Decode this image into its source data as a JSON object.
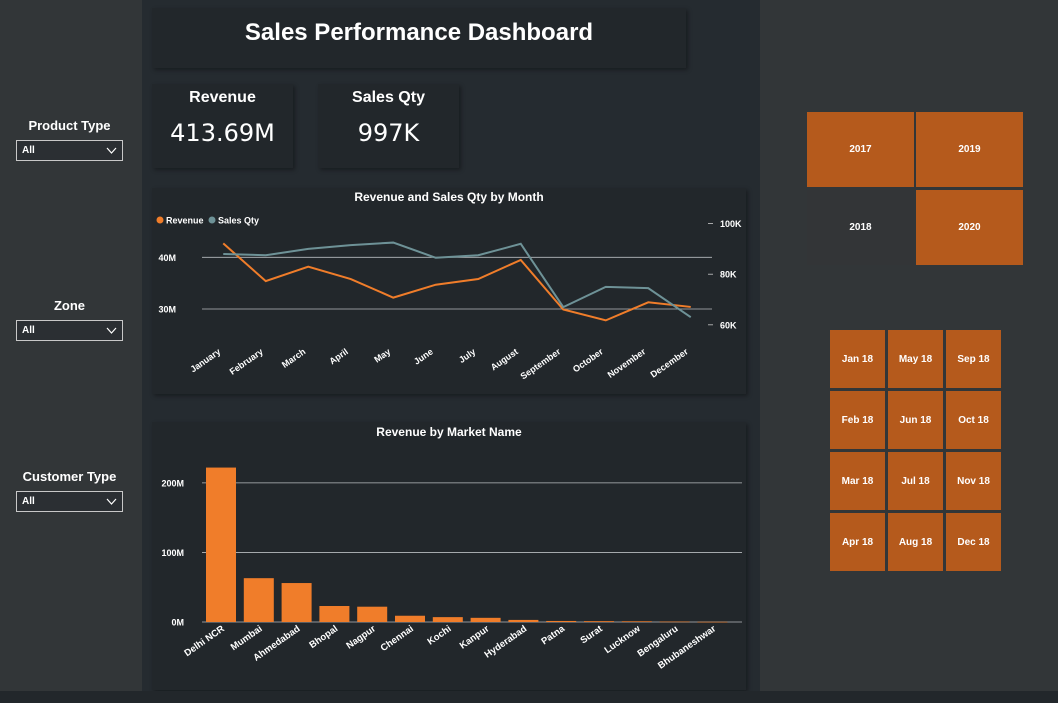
{
  "title": "Sales Performance Dashboard",
  "filters": [
    {
      "label": "Product Type",
      "value": "All"
    },
    {
      "label": "Zone",
      "value": "All"
    },
    {
      "label": "Customer Type",
      "value": "All"
    }
  ],
  "kpis": [
    {
      "label": "Revenue",
      "value": "413.69M"
    },
    {
      "label": "Sales Qty",
      "value": "997K"
    }
  ],
  "colors": {
    "accent": "#f07d2a",
    "secondary": "#6e9297",
    "tile_active": "#b55a1c",
    "tile_inactive": "#333537",
    "background": "#252b30",
    "panel": "#323638",
    "card": "#22272b"
  },
  "year_slicer": [
    {
      "label": "2017",
      "selected": true
    },
    {
      "label": "2019",
      "selected": true
    },
    {
      "label": "2018",
      "selected": false
    },
    {
      "label": "2020",
      "selected": true
    }
  ],
  "month_slicer": [
    "Jan 18",
    "May 18",
    "Sep 18",
    "Feb 18",
    "Jun 18",
    "Oct 18",
    "Mar 18",
    "Jul 18",
    "Nov 18",
    "Apr 18",
    "Aug 18",
    "Dec 18"
  ],
  "chart_data": [
    {
      "type": "line",
      "title": "Revenue and Sales Qty by Month",
      "legend_position": "top-left",
      "categories": [
        "January",
        "February",
        "March",
        "April",
        "May",
        "June",
        "July",
        "August",
        "September",
        "October",
        "November",
        "December"
      ],
      "series": [
        {
          "name": "Revenue",
          "axis": "left",
          "values": [
            42.7,
            35.4,
            38.2,
            35.8,
            32.2,
            34.7,
            35.8,
            39.5,
            29.9,
            27.8,
            31.3,
            30.4
          ]
        },
        {
          "name": "Sales Qty",
          "axis": "right",
          "values": [
            88,
            87.5,
            90,
            91.5,
            92.5,
            86.5,
            87.5,
            92,
            67,
            75,
            74.5,
            63
          ]
        }
      ],
      "y_left": {
        "ticks": [
          30,
          40
        ],
        "tick_labels": [
          "30M",
          "40M"
        ],
        "range": [
          24,
          48
        ]
      },
      "y_right": {
        "ticks": [
          60,
          80,
          100
        ],
        "tick_labels": [
          "60K",
          "80K",
          "100K"
        ],
        "range": [
          54,
          103
        ]
      },
      "grid": true
    },
    {
      "type": "bar",
      "title": "Revenue by Market Name",
      "categories": [
        "Delhi NCR",
        "Mumbai",
        "Ahmedabad",
        "Bhopal",
        "Nagpur",
        "Chennai",
        "Kochi",
        "Kanpur",
        "Hyderabad",
        "Patna",
        "Surat",
        "Lucknow",
        "Bengaluru",
        "Bhubaneshwar"
      ],
      "values": [
        222,
        63,
        56,
        23,
        22,
        9,
        7,
        6,
        3,
        1.5,
        1.2,
        1,
        0.6,
        0.3
      ],
      "ylim": [
        0,
        230
      ],
      "y_ticks": [
        0,
        100,
        200
      ],
      "y_tick_labels": [
        "0M",
        "100M",
        "200M"
      ],
      "grid": true
    }
  ]
}
